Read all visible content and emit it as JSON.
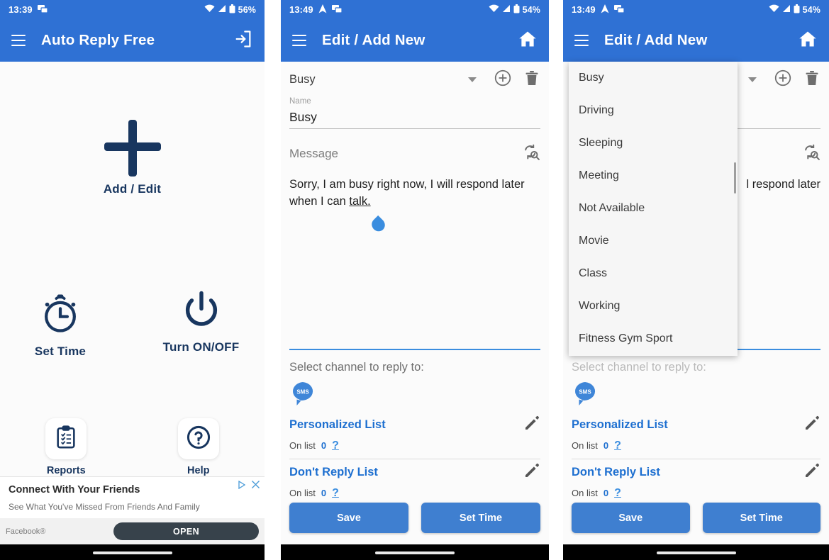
{
  "panels": [
    {
      "id": "home",
      "status": {
        "time": "13:39",
        "battery": "56%",
        "icons": [
          "screencast-icon",
          "wifi-icon",
          "signal-icon",
          "battery-icon"
        ]
      },
      "appbar": {
        "title": "Auto Reply Free",
        "menu_icon": "hamburger-icon",
        "action_icon": "exit-icon"
      },
      "tiles": [
        {
          "label": "Add / Edit",
          "icon": "plus-icon"
        },
        {
          "label": "Set Time",
          "icon": "stopwatch-icon"
        },
        {
          "label": "Turn ON/OFF",
          "icon": "power-icon"
        }
      ],
      "footer_tiles": [
        {
          "label": "Reports",
          "icon": "clipboard-icon"
        },
        {
          "label": "Help",
          "icon": "question-circle-icon"
        }
      ],
      "ad": {
        "title": "Connect With Your Friends",
        "subtitle": "See What You've Missed From Friends And Family",
        "brand": "Facebook®",
        "cta": "OPEN",
        "badge_icon": "adchoices-icon",
        "close_icon": "close-icon"
      }
    },
    {
      "id": "edit",
      "status": {
        "time": "13:49",
        "battery": "54%",
        "icons": [
          "navigation-icon",
          "screencast-icon",
          "wifi-icon",
          "signal-icon",
          "battery-icon"
        ]
      },
      "appbar": {
        "title": "Edit / Add New",
        "menu_icon": "hamburger-icon",
        "action_icon": "home-icon"
      },
      "profile_select": {
        "value": "Busy",
        "caret_icon": "chevron-down-icon",
        "add_icon": "plus-circle-icon",
        "delete_icon": "trash-icon"
      },
      "name_field": {
        "label": "Name",
        "value": "Busy"
      },
      "message_field": {
        "label": "Message",
        "refresh_icon": "sync-search-icon",
        "text_line1": "Sorry, I am busy right now, I will respond later",
        "text_line2_pre": "when I can ",
        "text_line2_link": "talk.",
        "cursor_icon": "text-cursor-handle"
      },
      "channel": {
        "label": "Select channel to reply to:",
        "sms_icon": "sms-bubble-icon"
      },
      "lists": [
        {
          "title": "Personalized List",
          "sub_label": "On list",
          "count": "0",
          "help_icon": "question-mark-icon",
          "edit_icon": "pencil-icon"
        },
        {
          "title": "Don't Reply List",
          "sub_label": "On list",
          "count": "0",
          "help_icon": "question-mark-icon",
          "edit_icon": "pencil-icon"
        }
      ],
      "buttons": [
        {
          "label": "Save"
        },
        {
          "label": "Set Time"
        }
      ]
    },
    {
      "id": "edit-dropdown",
      "status": {
        "time": "13:49",
        "battery": "54%",
        "icons": [
          "navigation-icon",
          "screencast-icon",
          "wifi-icon",
          "signal-icon",
          "battery-icon"
        ]
      },
      "appbar": {
        "title": "Edit / Add New",
        "menu_icon": "hamburger-icon",
        "action_icon": "home-icon"
      },
      "profile_select": {
        "value": "",
        "caret_icon": "chevron-down-icon",
        "add_icon": "plus-circle-icon",
        "delete_icon": "trash-icon"
      },
      "message_field": {
        "refresh_icon": "sync-search-icon",
        "text_visible": "l respond later"
      },
      "dropdown": {
        "options": [
          "Busy",
          "Driving",
          "Sleeping",
          "Meeting",
          "Not Available",
          "Movie",
          "Class",
          "Working",
          "Fitness Gym Sport"
        ],
        "scrollbar": "vertical-scrollbar"
      },
      "channel": {
        "label": "Select channel to reply to:",
        "sms_icon": "sms-bubble-icon"
      },
      "lists": [
        {
          "title": "Personalized List",
          "sub_label": "On list",
          "count": "0",
          "help_icon": "question-mark-icon",
          "edit_icon": "pencil-icon"
        },
        {
          "title": "Don't Reply List",
          "sub_label": "On list",
          "count": "0",
          "help_icon": "question-mark-icon",
          "edit_icon": "pencil-icon"
        }
      ],
      "buttons": [
        {
          "label": "Save"
        },
        {
          "label": "Set Time"
        }
      ]
    }
  ],
  "colors": {
    "appbar_blue": "#2f71d4",
    "accent_blue": "#3a8ddf",
    "link_blue": "#1d6fd0",
    "dark_navy": "#18365f",
    "button_blue": "#3f7fd0",
    "ad_button": "#37424b"
  }
}
